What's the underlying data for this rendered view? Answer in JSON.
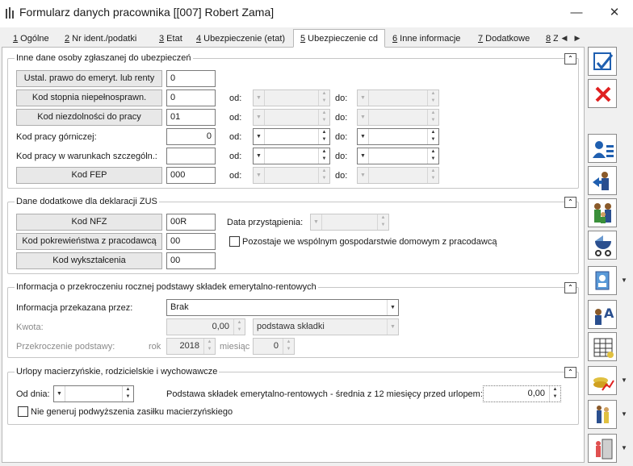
{
  "window": {
    "title": "Formularz danych pracownika [[007] Robert Zama]",
    "minimize": "—",
    "close": "✕"
  },
  "tabs": [
    {
      "key": "1",
      "label": " Ogólne"
    },
    {
      "key": "2",
      "label": " Nr ident./podatki"
    },
    {
      "key": "3",
      "label": " Etat"
    },
    {
      "key": "4",
      "label": " Ubezpieczenie (etat)"
    },
    {
      "key": "5",
      "label": " Ubezpieczenie cd"
    },
    {
      "key": "6",
      "label": " Inne informacje"
    },
    {
      "key": "7",
      "label": " Dodatkowe"
    },
    {
      "key": "8",
      "label": " Z"
    }
  ],
  "sections": {
    "s1": {
      "title": "Inne dane osoby zgłaszanej do ubezpieczeń",
      "od": "od:",
      "do": "do:",
      "rows": [
        {
          "label": "Ustal. prawo do emeryt. lub renty",
          "value": "0"
        },
        {
          "label": "Kod stopnia niepełnosprawn.",
          "value": "0"
        },
        {
          "label": "Kod niezdolności do pracy",
          "value": "01"
        },
        {
          "label": "Kod pracy górniczej:",
          "value": "0"
        },
        {
          "label": "Kod pracy w warunkach szczególn.:",
          "value": ""
        },
        {
          "label": "Kod FEP",
          "value": "000"
        }
      ]
    },
    "s2": {
      "title": "Dane dodatkowe dla deklaracji ZUS",
      "kod_nfz_label": "Kod NFZ",
      "kod_nfz_value": "00R",
      "data_przystapienia_label": "Data przystąpienia:",
      "pokrewienstwo_label": "Kod pokrewieństwa z pracodawcą",
      "pokrewienstwo_value": "00",
      "wspolne_gosp_label": "Pozostaje we wspólnym gospodarstwie domowym z pracodawcą",
      "wyksztalcenie_label": "Kod wykształcenia",
      "wyksztalcenie_value": "00"
    },
    "s3": {
      "title": "Informacja o przekroczeniu rocznej podstawy składek emerytalno-rentowych",
      "info_label": "Informacja przekazana przez:",
      "info_value": "Brak",
      "kwota_label": "Kwota:",
      "kwota_value": "0,00",
      "podstawa_value": "podstawa składki",
      "przekroczenie_label": "Przekroczenie podstawy:",
      "rok_label": "rok",
      "rok_value": "2018",
      "miesiac_label": "miesiąc",
      "miesiac_value": "0"
    },
    "s4": {
      "title": "Urlopy macierzyńskie, rodzicielskie i wychowawcze",
      "od_dnia_label": "Od dnia:",
      "podstawa_label": "Podstawa składek emerytalno-rentowych - średnia z 12 miesięcy przed urlopem:",
      "podstawa_value": "0,00",
      "nie_generuj_label": "Nie generuj podwyższenia zasiłku macierzyńskiego"
    }
  },
  "toolbar": [
    {
      "name": "save-icon"
    },
    {
      "name": "cancel-icon"
    },
    {
      "name": "employee-card-icon"
    },
    {
      "name": "person-arrow-icon"
    },
    {
      "name": "family-icon"
    },
    {
      "name": "stroller-icon"
    },
    {
      "name": "id-card-icon"
    },
    {
      "name": "person-text-icon"
    },
    {
      "name": "table-icon"
    },
    {
      "name": "chart-coins-icon"
    },
    {
      "name": "people-tools-icon"
    },
    {
      "name": "person-door-icon"
    }
  ],
  "colors": {
    "accent": "#1f5fb0",
    "cancel": "#e02020",
    "panel_bg": "#ffffff",
    "window_bg": "#f0f0f0"
  }
}
